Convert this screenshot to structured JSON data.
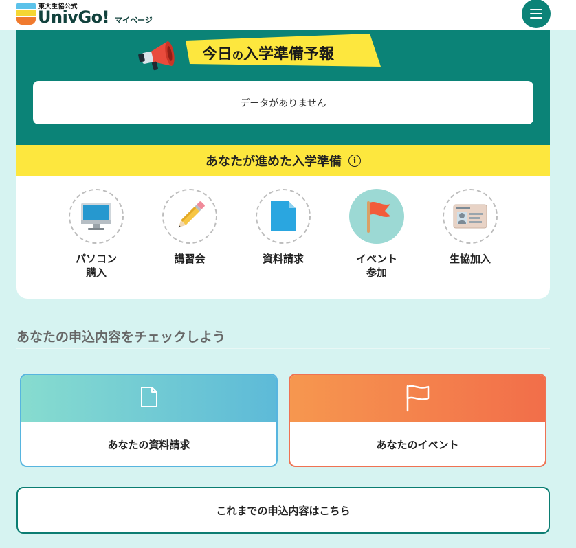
{
  "header": {
    "logo_small": "東大生協公式",
    "logo_main": "UnivGo!",
    "logo_sub": "マイページ"
  },
  "forecast": {
    "title_part1": "今日",
    "title_part2": "の",
    "title_part3": "入学準備予報",
    "empty_message": "データがありません"
  },
  "progress": {
    "title": "あなたが進めた入学準備",
    "info_glyph": "i",
    "steps": [
      {
        "label": "パソコン\n購入",
        "icon": "computer-icon",
        "done": false
      },
      {
        "label": "講習会",
        "icon": "pencil-icon",
        "done": false
      },
      {
        "label": "資料請求",
        "icon": "document-icon",
        "done": false
      },
      {
        "label": "イベント\n参加",
        "icon": "flag-icon",
        "done": true
      },
      {
        "label": "生協加入",
        "icon": "id-card-icon",
        "done": false
      }
    ]
  },
  "applications": {
    "section_title": "あなたの申込内容をチェックしよう",
    "docs_label": "あなたの資料請求",
    "events_label": "あなたのイベント",
    "history_label": "これまでの申込内容はこちら"
  },
  "colors": {
    "teal": "#0b8377",
    "yellow": "#fde73e",
    "background": "#d6f3f1",
    "orange": "#f26e4a",
    "blue": "#57b5df"
  }
}
